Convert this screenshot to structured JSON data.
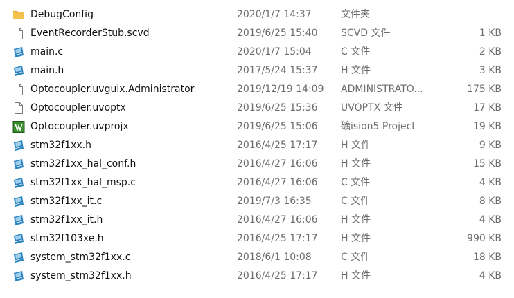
{
  "files": [
    {
      "icon": "folder-icon",
      "name": "DebugConfig",
      "date": "2020/1/7 14:37",
      "type": "文件夹",
      "size": ""
    },
    {
      "icon": "blank-file-icon",
      "name": "EventRecorderStub.scvd",
      "date": "2019/6/25 15:40",
      "type": "SCVD 文件",
      "size": "1 KB"
    },
    {
      "icon": "source-file-icon",
      "name": "main.c",
      "date": "2020/1/7 15:04",
      "type": "C 文件",
      "size": "2 KB"
    },
    {
      "icon": "source-file-icon",
      "name": "main.h",
      "date": "2017/5/24 15:37",
      "type": "H 文件",
      "size": "3 KB"
    },
    {
      "icon": "blank-file-icon",
      "name": "Optocoupler.uvguix.Administrator",
      "date": "2019/12/19 14:09",
      "type": "ADMINISTRATO...",
      "size": "175 KB"
    },
    {
      "icon": "blank-file-icon",
      "name": "Optocoupler.uvoptx",
      "date": "2019/6/25 15:36",
      "type": "UVOPTX 文件",
      "size": "17 KB"
    },
    {
      "icon": "keil-project-icon",
      "name": "Optocoupler.uvprojx",
      "date": "2019/6/25 15:06",
      "type": "礦ision5 Project",
      "size": "19 KB"
    },
    {
      "icon": "source-file-icon",
      "name": "stm32f1xx.h",
      "date": "2016/4/25 17:17",
      "type": "H 文件",
      "size": "9 KB"
    },
    {
      "icon": "source-file-icon",
      "name": "stm32f1xx_hal_conf.h",
      "date": "2016/4/27 16:06",
      "type": "H 文件",
      "size": "15 KB"
    },
    {
      "icon": "source-file-icon",
      "name": "stm32f1xx_hal_msp.c",
      "date": "2016/4/27 16:06",
      "type": "C 文件",
      "size": "4 KB"
    },
    {
      "icon": "source-file-icon",
      "name": "stm32f1xx_it.c",
      "date": "2019/7/3 16:35",
      "type": "C 文件",
      "size": "8 KB"
    },
    {
      "icon": "source-file-icon",
      "name": "stm32f1xx_it.h",
      "date": "2016/4/27 16:06",
      "type": "H 文件",
      "size": "4 KB"
    },
    {
      "icon": "source-file-icon",
      "name": "stm32f103xe.h",
      "date": "2016/4/25 17:17",
      "type": "H 文件",
      "size": "990 KB"
    },
    {
      "icon": "source-file-icon",
      "name": "system_stm32f1xx.c",
      "date": "2018/6/1 10:08",
      "type": "C 文件",
      "size": "18 KB"
    },
    {
      "icon": "source-file-icon",
      "name": "system_stm32f1xx.h",
      "date": "2016/4/25 17:17",
      "type": "H 文件",
      "size": "4 KB"
    }
  ],
  "colors": {
    "folder": "#f2c14e",
    "folder_tab": "#e0a92f",
    "source_icon": "#2e86c1",
    "source_icon_light": "#9fd0ee",
    "keil_icon": "#3a8a2e",
    "secondary_text": "#6d6d6d"
  }
}
